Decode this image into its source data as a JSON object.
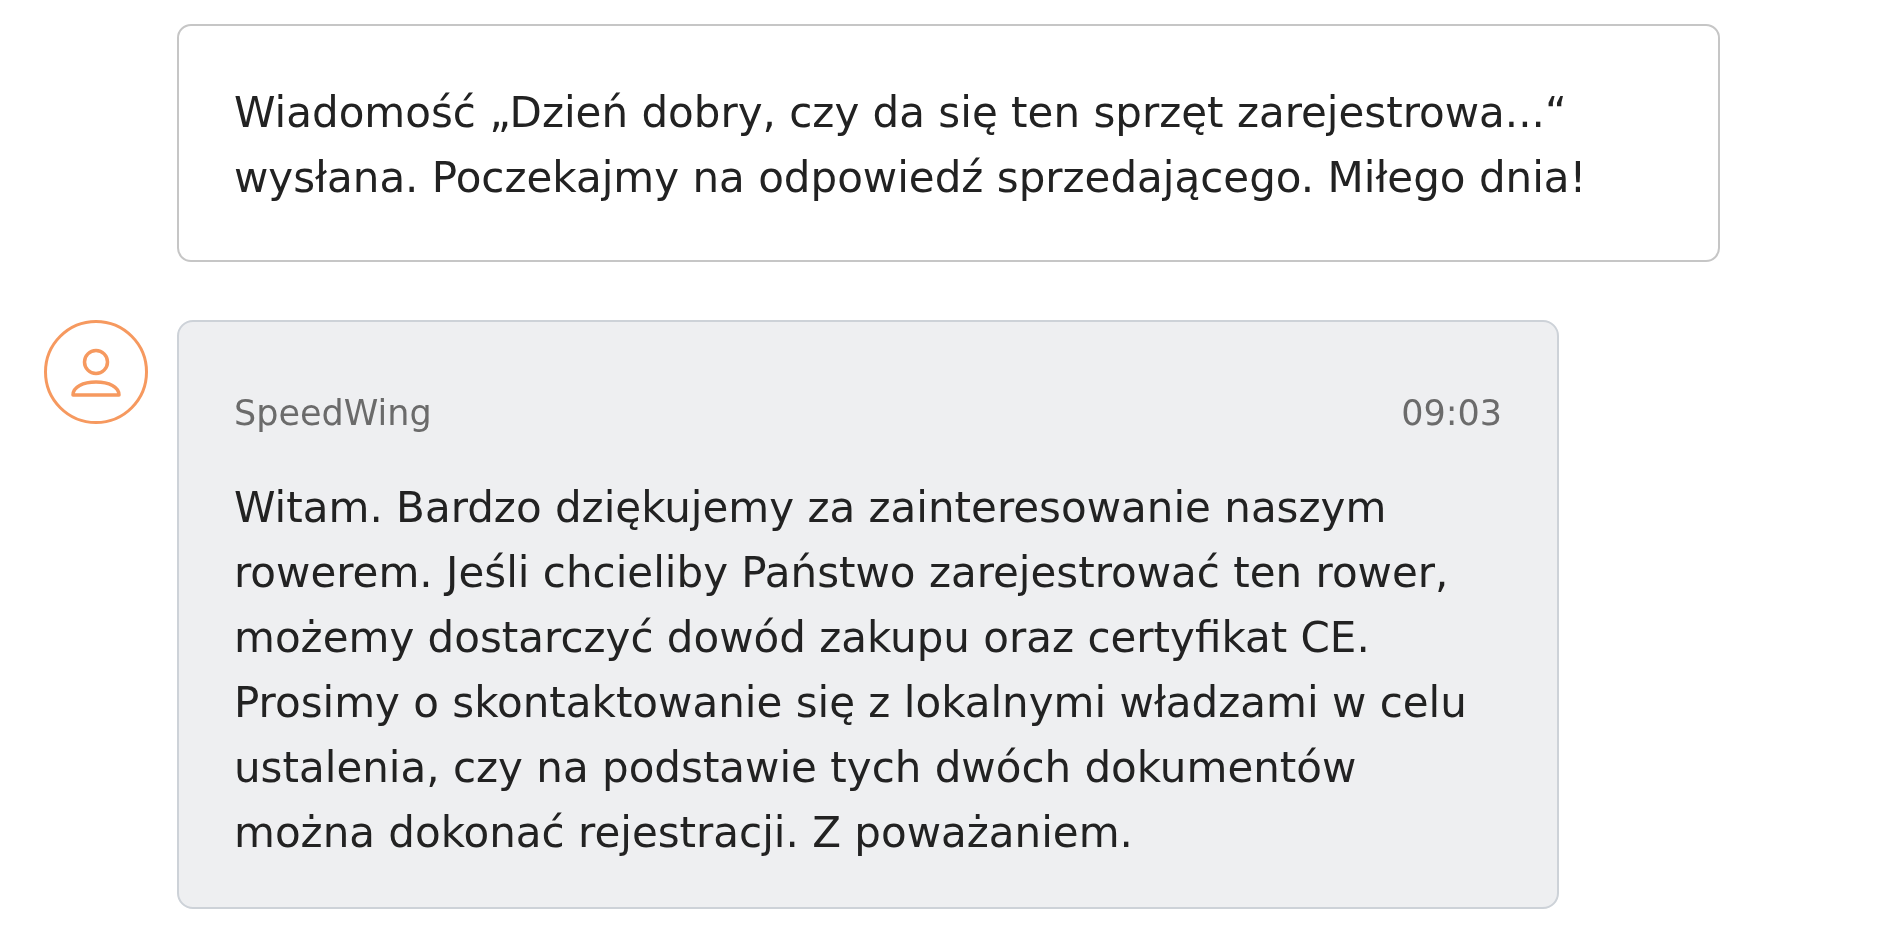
{
  "messages": [
    {
      "kind": "system",
      "text": "Wiadomość „Dzień dobry, czy da się ten sprzęt zarejestrowa...“ wysłana. Poczekajmy na odpowiedź sprzedającego. Miłego dnia!"
    },
    {
      "kind": "incoming",
      "sender": "SpeedWing",
      "time": "09:03",
      "text": "Witam. Bardzo dziękujemy za zainteresowanie naszym rowerem. Jeśli chcieliby Państwo zarejestrować ten rower, możemy dostarczyć dowód zakupu oraz certyfikat CE. Prosimy o skontaktowanie się z lokalnymi władzami w celu ustalenia, czy na podstawie tych dwóch dokumentów można dokonać rejestracji. Z poważaniem."
    }
  ]
}
